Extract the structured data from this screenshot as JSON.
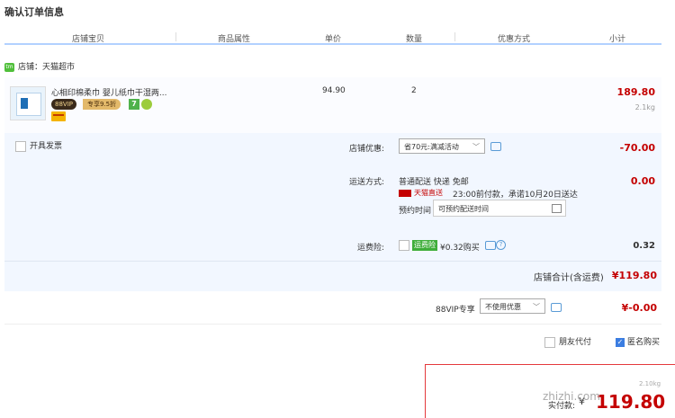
{
  "page_title": "确认订单信息",
  "columns": [
    "店铺宝贝",
    "商品属性",
    "单价",
    "数量",
    "优惠方式",
    "小计"
  ],
  "shop": {
    "label": "店铺：天猫超市",
    "icon": "tmall-shop-icon"
  },
  "item": {
    "name": "心相印棉柔巾 婴儿纸巾干湿两...",
    "vip_tag": "88VIP",
    "vip_discount": "专享9.5折",
    "badge_7": "7",
    "price": "94.90",
    "quantity": "2",
    "subtotal": "189.80",
    "weight": "2.1kg"
  },
  "invoice": {
    "label": "开具发票"
  },
  "shop_discount": {
    "label": "店铺优惠:",
    "selected": "省70元:满减活动",
    "amount": "-70.00"
  },
  "shipping": {
    "label": "运送方式:",
    "method": "普通配送 快递 免邮",
    "tmall_express": "天猫直送",
    "note": "23:00前付款，承诺10月20日送达",
    "appointment_label": "预约时间",
    "appointment_placeholder": "可预约配送时间",
    "amount": "0.00"
  },
  "insurance": {
    "label": "运费险:",
    "badge": "运费险",
    "price_text": "¥0.32购买",
    "amount": "0.32"
  },
  "shop_total": {
    "label": "店铺合计(含运费)",
    "amount": "¥119.80"
  },
  "vip_row": {
    "label": "88VIP专享",
    "selected": "不使用优惠",
    "amount": "¥-0.00"
  },
  "bottom": {
    "friend_pay": "朋友代付",
    "anonymous": "匿名购买"
  },
  "paybox": {
    "actual_label": "实付款:",
    "currency": "¥",
    "actual_amount": "119.80",
    "weight": "2.10kg"
  },
  "watermark": "zhizhi.com",
  "colors": {
    "price_red": "#c40000",
    "header_line": "#b2d1ff",
    "panel_bg": "#f2f7ff",
    "vip_dark": "#3a2a1a",
    "vip_gold": "#e3b96a"
  }
}
